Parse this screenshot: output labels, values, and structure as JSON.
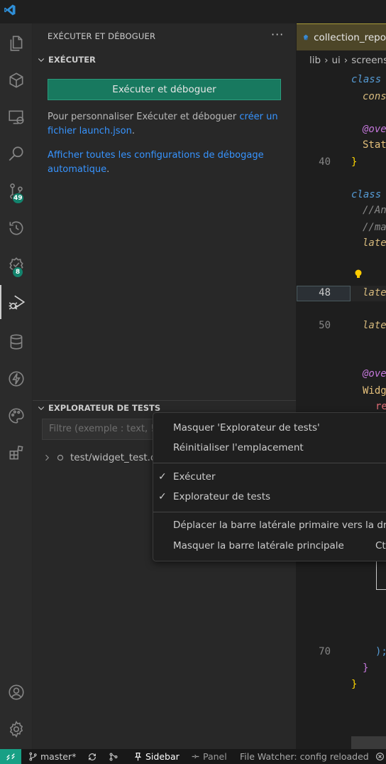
{
  "sidebar": {
    "title": "EXÉCUTER ET DÉBOGUER",
    "more": "···",
    "run_section": {
      "title": "EXÉCUTER",
      "button_label": "Exécuter et déboguer",
      "customize_text": "Pour personnaliser Exécuter et déboguer ",
      "customize_link": "créer un fichier launch.json",
      "customize_end": ".",
      "auto_link": "Afficher toutes les configurations de débogage automatique",
      "auto_end": "."
    },
    "test_section": {
      "title": "EXPLORATEUR DE TESTS",
      "filter_placeholder": "Filtre (exemple : text, !e",
      "tree_item": "test/widget_test.d"
    }
  },
  "activity_bar": {
    "source_control_badge": "49",
    "testing_badge": "8"
  },
  "editor": {
    "tab_label": "collection_repo",
    "breadcrumbs": [
      "lib",
      "ui",
      "screens"
    ],
    "line_numbers": [
      {
        "n": "40",
        "active": false
      },
      {
        "n": "48",
        "active": true
      },
      {
        "n": "50",
        "active": false
      },
      {
        "n": "70",
        "active": false
      }
    ],
    "code": {
      "l1": "class",
      "l2": "cons",
      "l3": "@ove",
      "l4": "Stat",
      "l5": "}",
      "l6": "class",
      "l7": "//An",
      "l8": "//ma",
      "l9": "late",
      "l10": "late",
      "l11": "late",
      "l12": "@ove",
      "l13": "Widg",
      "l14": "re",
      "l15": ");",
      "l16": "}",
      "l17": "}"
    }
  },
  "context_menu": {
    "items": [
      {
        "label": "Masquer 'Explorateur de tests'",
        "checked": false
      },
      {
        "label": "Réinitialiser l'emplacement",
        "checked": false
      },
      {
        "label": "Exécuter",
        "checked": true
      },
      {
        "label": "Explorateur de tests",
        "checked": true
      },
      {
        "label": "Déplacer la barre latérale primaire vers la droite",
        "checked": false
      },
      {
        "label": "Masquer la barre latérale principale",
        "checked": false,
        "shortcut": "Ct"
      }
    ],
    "check_glyph": "✓"
  },
  "status_bar": {
    "branch": "master*",
    "sidebar_label": "Sidebar",
    "panel_label": "Panel",
    "watcher": "File Watcher: config reloaded"
  },
  "colors": {
    "accent_button": "#18795f",
    "badge": "#13836d",
    "link": "#3794ff",
    "remote": "#17a085"
  }
}
